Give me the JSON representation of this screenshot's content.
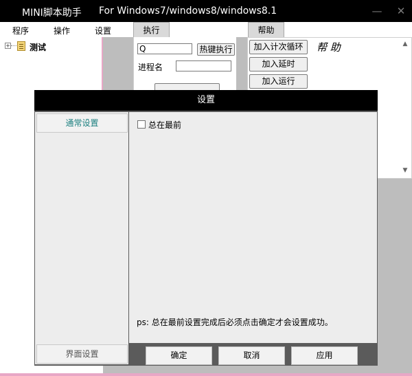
{
  "window": {
    "app_name": "MINI脚本助手",
    "subtitle": "For Windows7/windows8/windows8.1",
    "minimize_glyph": "—",
    "close_glyph": "✕"
  },
  "menu": {
    "items": [
      "程序",
      "操作",
      "设置"
    ]
  },
  "tabs": {
    "execute": "执行",
    "help": "帮助"
  },
  "tree": {
    "expander": "+",
    "root_label": "测试"
  },
  "execute_panel": {
    "hotkey_value": "Q",
    "hotkey_button": "热键执行",
    "process_label": "进程名",
    "process_value": ""
  },
  "help_panel": {
    "add_loop": "加入计次循环",
    "add_delay": "加入延时",
    "add_run": "加入运行",
    "help_text": "帮 助",
    "scroll_up": "▲",
    "scroll_down": "▼"
  },
  "dialog": {
    "title": "设置",
    "nav_general": "通常设置",
    "nav_ui": "界面设置",
    "always_on_top_label": "总在最前",
    "note": "ps: 总在最前设置完成后必须点击确定才会设置成功。",
    "ok": "确定",
    "cancel": "取消",
    "apply": "应用"
  },
  "colors": {
    "accent_teal": "#1a7f7f",
    "pink_border": "#e8a7c6"
  }
}
